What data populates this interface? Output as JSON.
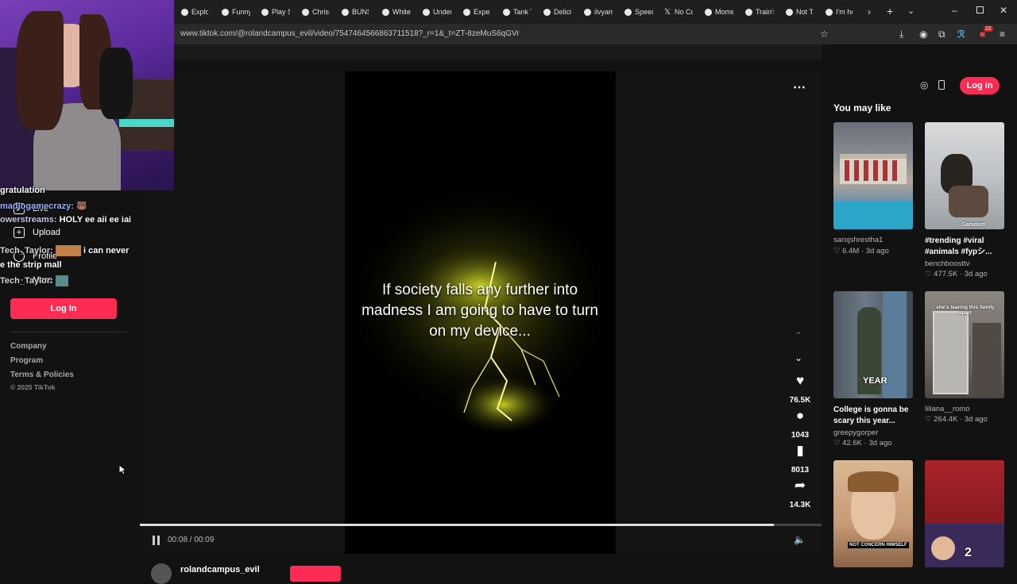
{
  "browser": {
    "tabs": [
      "Explor",
      "Funny",
      "Play S",
      "Christ",
      "BUNS",
      "White",
      "Under",
      "Exper",
      "Tank T",
      "Delici",
      "ilvyam",
      "Speed",
      "No Co",
      "Mome",
      "Train's",
      "Not T",
      "I'm hc"
    ],
    "url": "www.tiktok.com/@rolandcampus_evil/video/7547464566863711518?_r=1&_t=ZT-8zeMuS6qGVr",
    "badge_count": "22"
  },
  "sidebar": {
    "items": [
      {
        "label": "Live",
        "icon": "live-icon"
      },
      {
        "label": "Upload",
        "icon": "plus-icon"
      },
      {
        "label": "Profile",
        "icon": "profile-icon"
      },
      {
        "label": "More",
        "icon": "more-icon"
      }
    ],
    "login_label": "Log In",
    "footer": [
      "Company",
      "Program",
      "Terms & Policies"
    ],
    "copyright": "© 2025 TikTok"
  },
  "chat": [
    {
      "user": "",
      "text": "gratulation"
    },
    {
      "user": "madlogamecrazy:",
      "text": ""
    },
    {
      "user": "owerstreams:",
      "text": "HOLY ee aii ee iai"
    },
    {
      "user": "Tech_Taylor:",
      "text": "i can never"
    },
    {
      "user": "",
      "text": "e the strip mall"
    },
    {
      "user": "Tech_Taylor:",
      "text": ""
    }
  ],
  "video": {
    "caption": "If society falls any further into madness I am going to have to turn on my device...",
    "time": "00:08 / 00:09",
    "progress": 0.93,
    "author": "rolandcampus_evil"
  },
  "actions": [
    {
      "name": "like",
      "icon": "heart-icon",
      "count": "76.5K"
    },
    {
      "name": "comment",
      "icon": "comment-icon",
      "count": "1043"
    },
    {
      "name": "save",
      "icon": "bookmark-icon",
      "count": "8013"
    },
    {
      "name": "share",
      "icon": "share-icon",
      "count": "14.3K"
    }
  ],
  "right": {
    "login_label": "Log in",
    "heading": "You may like",
    "cards": [
      {
        "title": "",
        "user": "sarojshrestha1",
        "likes": "6.4M",
        "age": "3d ago"
      },
      {
        "title": "#trending #viral #animals #fypシ...",
        "user": "benchboosttv",
        "likes": "477.5K",
        "age": "3d ago"
      },
      {
        "title": "College is gonna be scary this year...",
        "user": "greepygorper",
        "likes": "42.6K",
        "age": "3d ago"
      },
      {
        "title": "",
        "user": "liliana__romo",
        "likes": "264.4K",
        "age": "3d ago"
      },
      {
        "title": "",
        "user": "",
        "likes": "",
        "age": ""
      },
      {
        "title": "",
        "user": "",
        "likes": "",
        "age": ""
      }
    ],
    "thumb_texts": [
      "Gamdom",
      "YEAR",
      "she's tearing this family apart",
      "NOT CONCERN HIMSELF",
      "2"
    ]
  },
  "colors": {
    "accent": "#fe2c55",
    "background": "#121212",
    "video_bg": "#000000"
  }
}
